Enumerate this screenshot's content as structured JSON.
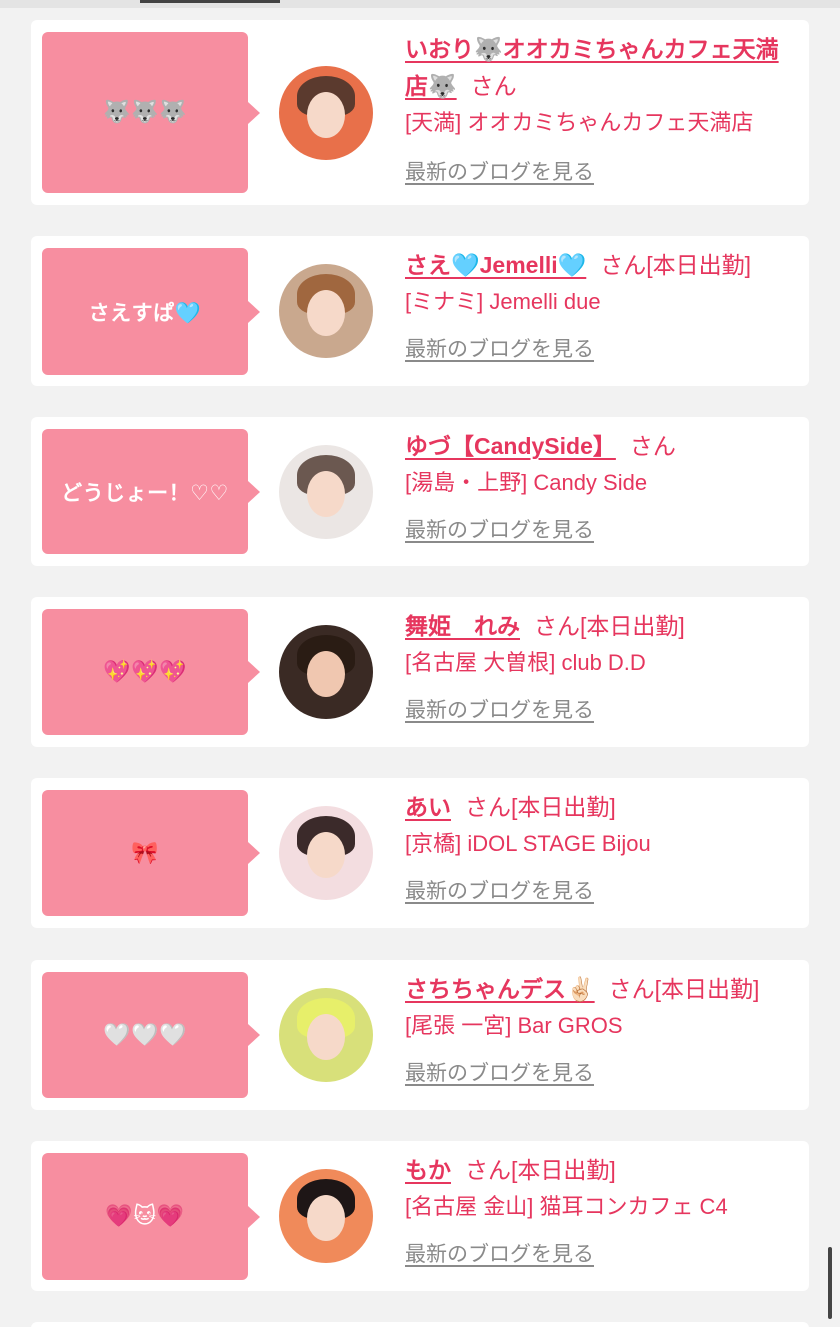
{
  "entries": [
    {
      "bubble": "🐺🐺🐺",
      "name": "いおり🐺オオカミちゃんカフェ天満店🐺",
      "suffix": "さん",
      "shift": "",
      "shop": "[天満] オオカミちゃんカフェ天満店",
      "blog": "最新のブログを見る"
    },
    {
      "bubble": "さえすぱ🩵",
      "name": "さえ🩵Jemelli🩵",
      "suffix": "さん",
      "shift": "[本日出勤]",
      "shop": "[ミナミ] Jemelli due",
      "blog": "最新のブログを見る"
    },
    {
      "bubble": "どうじょー！♡♡",
      "name": "ゆづ【CandySide】",
      "suffix": "さん",
      "shift": "",
      "shop": "[湯島・上野] Candy Side",
      "blog": "最新のブログを見る"
    },
    {
      "bubble": "💖💖💖",
      "name": "舞姫　れみ",
      "suffix": "さん",
      "shift": "[本日出勤]",
      "shop": "[名古屋 大曽根] club D.D",
      "blog": "最新のブログを見る"
    },
    {
      "bubble": "🎀",
      "name": "あい",
      "suffix": "さん",
      "shift": "[本日出勤]",
      "shop": "[京橋] iDOL STAGE Bijou",
      "blog": "最新のブログを見る"
    },
    {
      "bubble": "🤍🤍🤍",
      "name": "さちちゃんデス✌🏻",
      "suffix": "さん",
      "shift": "[本日出勤]",
      "shop": "[尾張 一宮] Bar GROS",
      "blog": "最新のブログを見る"
    },
    {
      "bubble": "💗🐱💗",
      "name": "もか",
      "suffix": "さん",
      "shift": "[本日出勤]",
      "shop": "[名古屋 金山] 猫耳コンカフェ C4",
      "blog": "最新のブログを見る"
    }
  ],
  "colors": {
    "accent": "#e6365e",
    "bubble": "#f78ea0",
    "link_gray": "#8a8a8a",
    "background": "#f2f2f2"
  }
}
